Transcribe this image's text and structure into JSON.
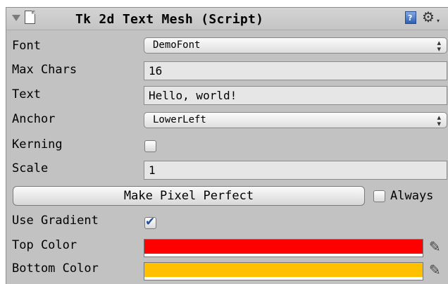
{
  "component": {
    "title": "Tk 2d Text Mesh (Script)",
    "help_icon_glyph": "?",
    "settings_icon_glyph": "⚙",
    "settings_caret_glyph": "▾"
  },
  "fields": {
    "font": {
      "label": "Font",
      "value": "DemoFont",
      "arrows": "⇕"
    },
    "max_chars": {
      "label": "Max Chars",
      "value": "16"
    },
    "text": {
      "label": "Text",
      "value": "Hello, world!"
    },
    "anchor": {
      "label": "Anchor",
      "value": "LowerLeft",
      "arrows": "⇕"
    },
    "kerning": {
      "label": "Kerning",
      "checked": false
    },
    "scale": {
      "label": "Scale",
      "value": "1"
    },
    "pixel_perfect": {
      "button_label": "Make Pixel Perfect",
      "always_label": "Always",
      "always_checked": false
    },
    "use_gradient": {
      "label": "Use Gradient",
      "checked": true,
      "tick": "✔"
    },
    "top_color": {
      "label": "Top Color",
      "color": "#ff0000"
    },
    "bottom_color": {
      "label": "Bottom Color",
      "color": "#ffc000"
    },
    "picker_glyph": "✎"
  }
}
